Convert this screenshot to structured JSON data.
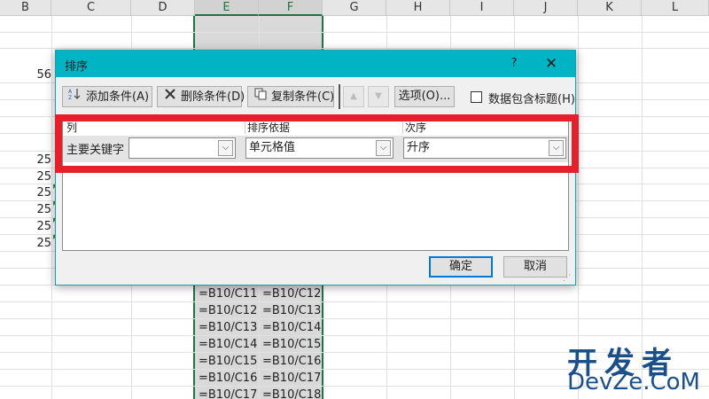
{
  "sheet": {
    "columns": [
      "B",
      "C",
      "D",
      "E",
      "F",
      "G",
      "H",
      "I",
      "J",
      "K",
      "L"
    ],
    "number_cells": [
      "56",
      "25",
      "25",
      "25",
      "25",
      "25",
      "25"
    ],
    "col_e_formulas": [
      "=B10/C11",
      "=B10/C12",
      "=B10/C13",
      "=B10/C14",
      "=B10/C15",
      "=B10/C16",
      "=B10/C17"
    ],
    "col_f_formulas": [
      "=B10/C12",
      "=B10/C13",
      "=B10/C14",
      "=B10/C15",
      "=B10/C16",
      "=B10/C17",
      "=B10/C18"
    ]
  },
  "dialog": {
    "title": "排序",
    "help_label": "?",
    "close_label": "✕",
    "toolbar": {
      "add_label": "添加条件(A)",
      "delete_label": "删除条件(D)",
      "copy_label": "复制条件(C)",
      "options_label": "选项(O)...",
      "header_checkbox_label": "数据包含标题(H)"
    },
    "headers": {
      "column": "列",
      "sort_on": "排序依据",
      "order": "次序"
    },
    "row": {
      "label": "主要关键字",
      "column_value": "",
      "sort_on_value": "单元格值",
      "order_value": "升序"
    },
    "ok_label": "确定",
    "cancel_label": "取消"
  },
  "watermark": {
    "line1": "开发者",
    "line2": "DevZe.CoM"
  },
  "colors": {
    "title_bar": "#00b4c4",
    "highlight": "#e5202a",
    "excel_green": "#217346",
    "watermark": "#1a4f8a"
  }
}
